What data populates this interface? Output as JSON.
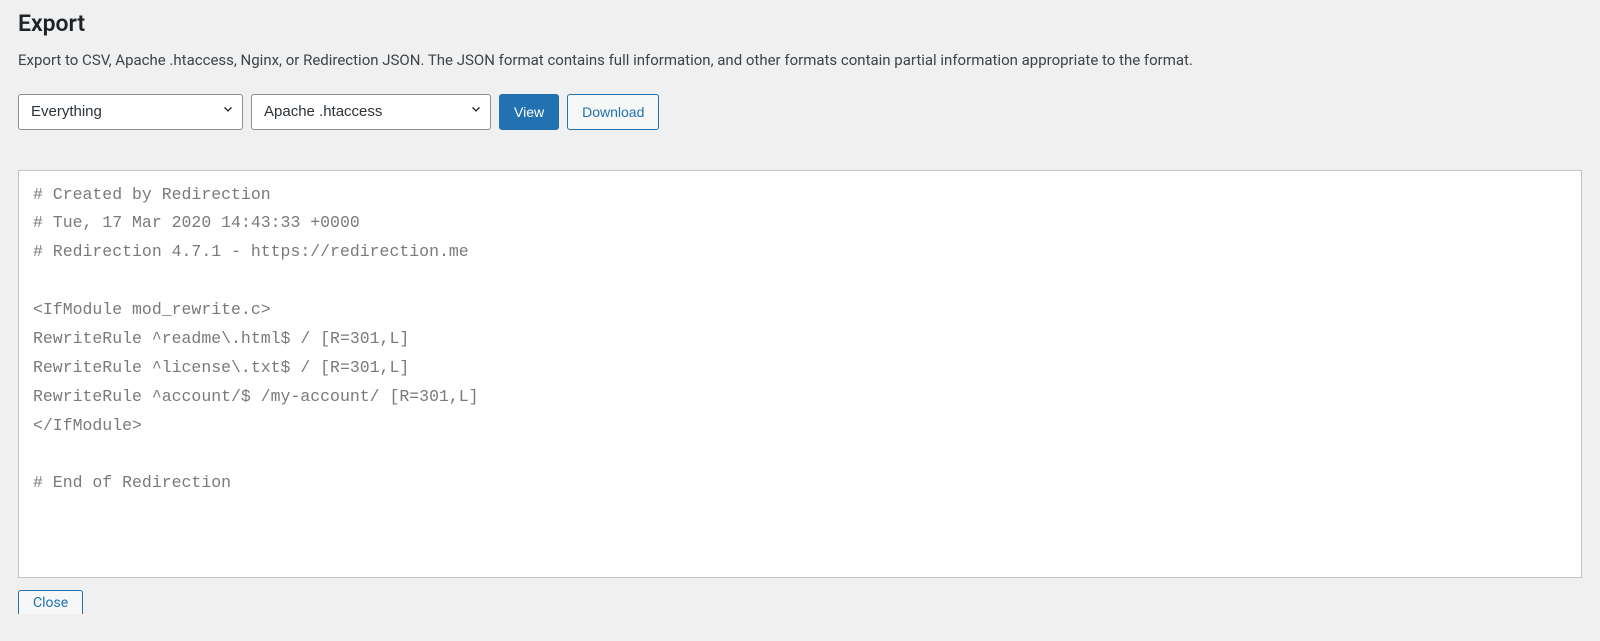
{
  "header": {
    "title": "Export",
    "description": "Export to CSV, Apache .htaccess, Nginx, or Redirection JSON. The JSON format contains full information, and other formats contain partial information appropriate to the format."
  },
  "controls": {
    "scope_select": {
      "selected": "Everything"
    },
    "format_select": {
      "selected": "Apache .htaccess"
    },
    "view_button": "View",
    "download_button": "Download"
  },
  "export_output": "# Created by Redirection\n# Tue, 17 Mar 2020 14:43:33 +0000\n# Redirection 4.7.1 - https://redirection.me\n\n<IfModule mod_rewrite.c>\nRewriteRule ^readme\\.html$ / [R=301,L]\nRewriteRule ^license\\.txt$ / [R=301,L]\nRewriteRule ^account/$ /my-account/ [R=301,L]\n</IfModule>\n\n# End of Redirection",
  "footer": {
    "close_button": "Close"
  }
}
